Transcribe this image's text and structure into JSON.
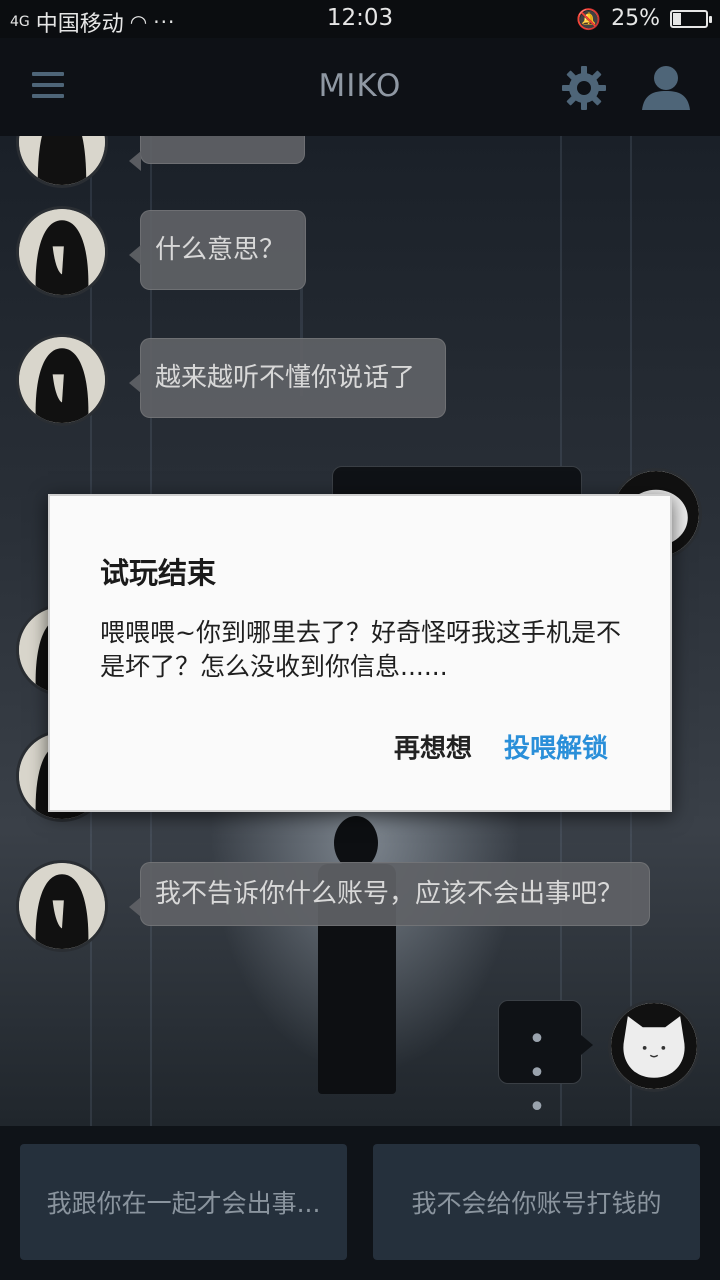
{
  "status_bar": {
    "signal_label": "4G",
    "carrier": "中国移动",
    "dots": "···",
    "time": "12:03",
    "battery_percent": "25%",
    "battery_level": 0.25
  },
  "header": {
    "title": "MIKO"
  },
  "messages": [
    {
      "text": "什么意思？"
    },
    {
      "text": "越来越听不懂你说话了"
    },
    {
      "text": "我不告诉你什么账号，应该不会出事吧？"
    }
  ],
  "typing_indicator": "• • •",
  "replies": [
    {
      "label": "我跟你在一起才会出事..."
    },
    {
      "label": "我不会给你账号打钱的"
    }
  ],
  "dialog": {
    "title": "试玩结束",
    "message": "喂喂喂~你到哪里去了？好奇怪呀我这手机是不是坏了？怎么没收到你信息......",
    "cancel_label": "再想想",
    "confirm_label": "投喂解锁"
  },
  "colors": {
    "accent": "#2a8fd9",
    "nav_icon": "#4e6578"
  }
}
